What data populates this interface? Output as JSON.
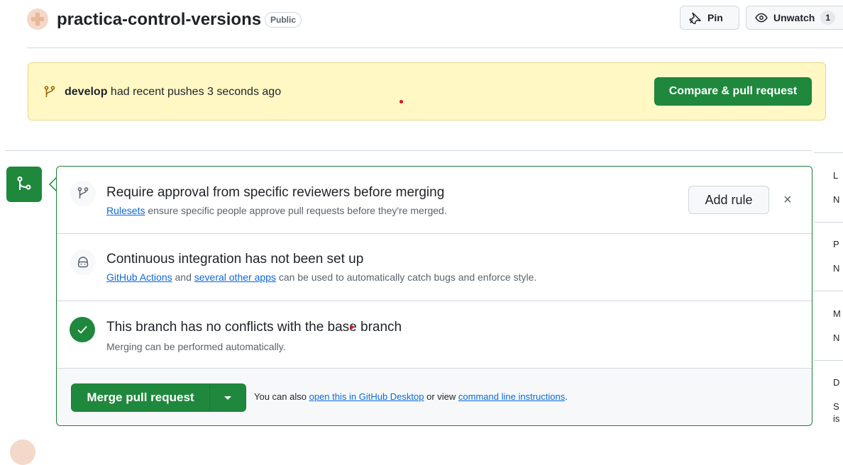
{
  "header": {
    "repo_name": "practica-control-versions",
    "visibility": "Public",
    "pin_label": "Pin",
    "unwatch_label": "Unwatch",
    "watch_count": "1"
  },
  "banner": {
    "branch": "develop",
    "message": "had recent pushes 3 seconds ago",
    "button": "Compare & pull request"
  },
  "mergebox": {
    "rules": {
      "title": "Require approval from specific reviewers before merging",
      "link": "Rulesets",
      "text": "ensure specific people approve pull requests before they're merged.",
      "button": "Add rule",
      "close": "×"
    },
    "ci": {
      "title": "Continuous integration has not been set up",
      "link1": "GitHub Actions",
      "and": "and",
      "link2": "several other apps",
      "text": "can be used to automatically catch bugs and enforce style."
    },
    "conflicts": {
      "title": "This branch has no conflicts with the base branch",
      "subtitle": "Merging can be performed automatically."
    },
    "footer": {
      "merge_button": "Merge pull request",
      "text_prefix": "You can also",
      "link1": "open this in GitHub Desktop",
      "middle": "or view",
      "link2": "command line instructions",
      "suffix": "."
    }
  },
  "sidebar": {
    "letters": [
      "L",
      "N",
      "P",
      "N",
      "M",
      "N",
      "D",
      "S",
      "is"
    ]
  },
  "colors": {
    "primary_green": "#1f883d",
    "banner_yellow": "#fff8c5",
    "link_blue": "#0969da"
  }
}
